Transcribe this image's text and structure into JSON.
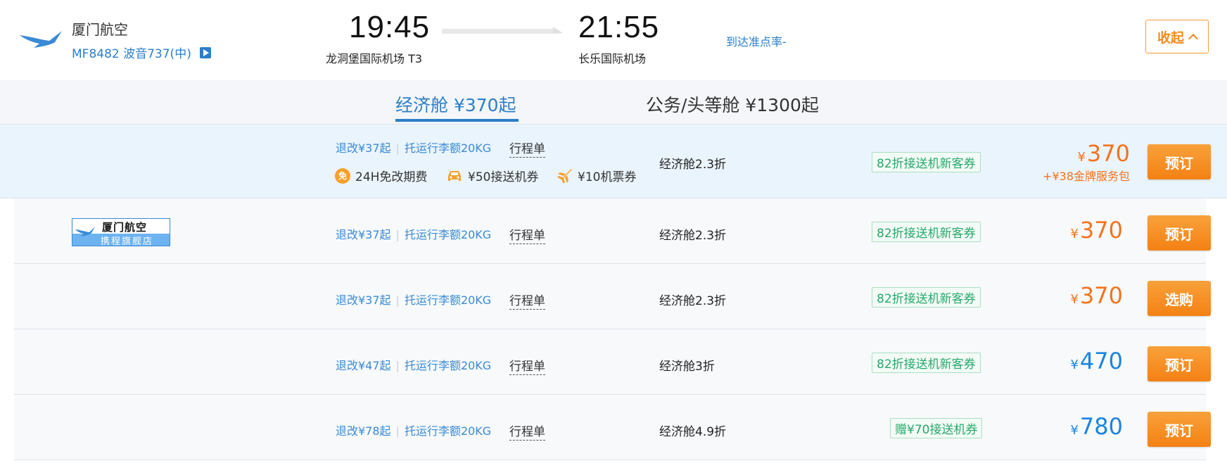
{
  "flight": {
    "airline_name": "厦门航空",
    "flight_meta": "MF8482 波音737(中)",
    "dep_time": "19:45",
    "dep_airport": "龙洞堡国际机场 T3",
    "arr_time": "21:55",
    "arr_airport": "长乐国际机场",
    "ontime_rate": "到达准点率-",
    "collapse_label": "收起"
  },
  "tabs": [
    {
      "label": "经济舱 ¥370起",
      "active": true
    },
    {
      "label": "公务/头等舱 ¥1300起",
      "active": false
    }
  ],
  "store": {
    "name": "厦门航空",
    "subtitle": "携程旗舰店"
  },
  "fares": [
    {
      "refund": "退改¥37起",
      "baggage": "托运行李额20KG",
      "itinerary": "行程单",
      "cabin": "经济舱2.3折",
      "promo": "82折接送机新客券",
      "currency": "¥",
      "price": "370",
      "price_color": "orange",
      "extra": "+¥38金牌服务包",
      "button": "预订",
      "perks": [
        {
          "icon": "waiver-icon",
          "label": "24H免改期费"
        },
        {
          "icon": "car-icon",
          "label": "¥50接送机券"
        },
        {
          "icon": "plane-icon",
          "label": "¥10机票券"
        }
      ]
    },
    {
      "refund": "退改¥37起",
      "baggage": "托运行李额20KG",
      "itinerary": "行程单",
      "cabin": "经济舱2.3折",
      "promo": "82折接送机新客券",
      "currency": "¥",
      "price": "370",
      "price_color": "orange",
      "button": "预订"
    },
    {
      "refund": "退改¥37起",
      "baggage": "托运行李额20KG",
      "itinerary": "行程单",
      "cabin": "经济舱2.3折",
      "promo": "82折接送机新客券",
      "currency": "¥",
      "price": "370",
      "price_color": "orange",
      "button": "选购"
    },
    {
      "refund": "退改¥47起",
      "baggage": "托运行李额20KG",
      "itinerary": "行程单",
      "cabin": "经济舱3折",
      "promo": "82折接送机新客券",
      "currency": "¥",
      "price": "470",
      "price_color": "blue",
      "button": "预订"
    },
    {
      "refund": "退改¥78起",
      "baggage": "托运行李额20KG",
      "itinerary": "行程单",
      "cabin": "经济舱4.9折",
      "promo": "赠¥70接送机券",
      "currency": "¥",
      "price": "780",
      "price_color": "blue",
      "button": "预订"
    }
  ],
  "colors": {
    "accent_blue": "#2b7ec9",
    "price_orange": "#f5731d",
    "button_orange": "#f48114",
    "promo_green": "#27a86b"
  }
}
